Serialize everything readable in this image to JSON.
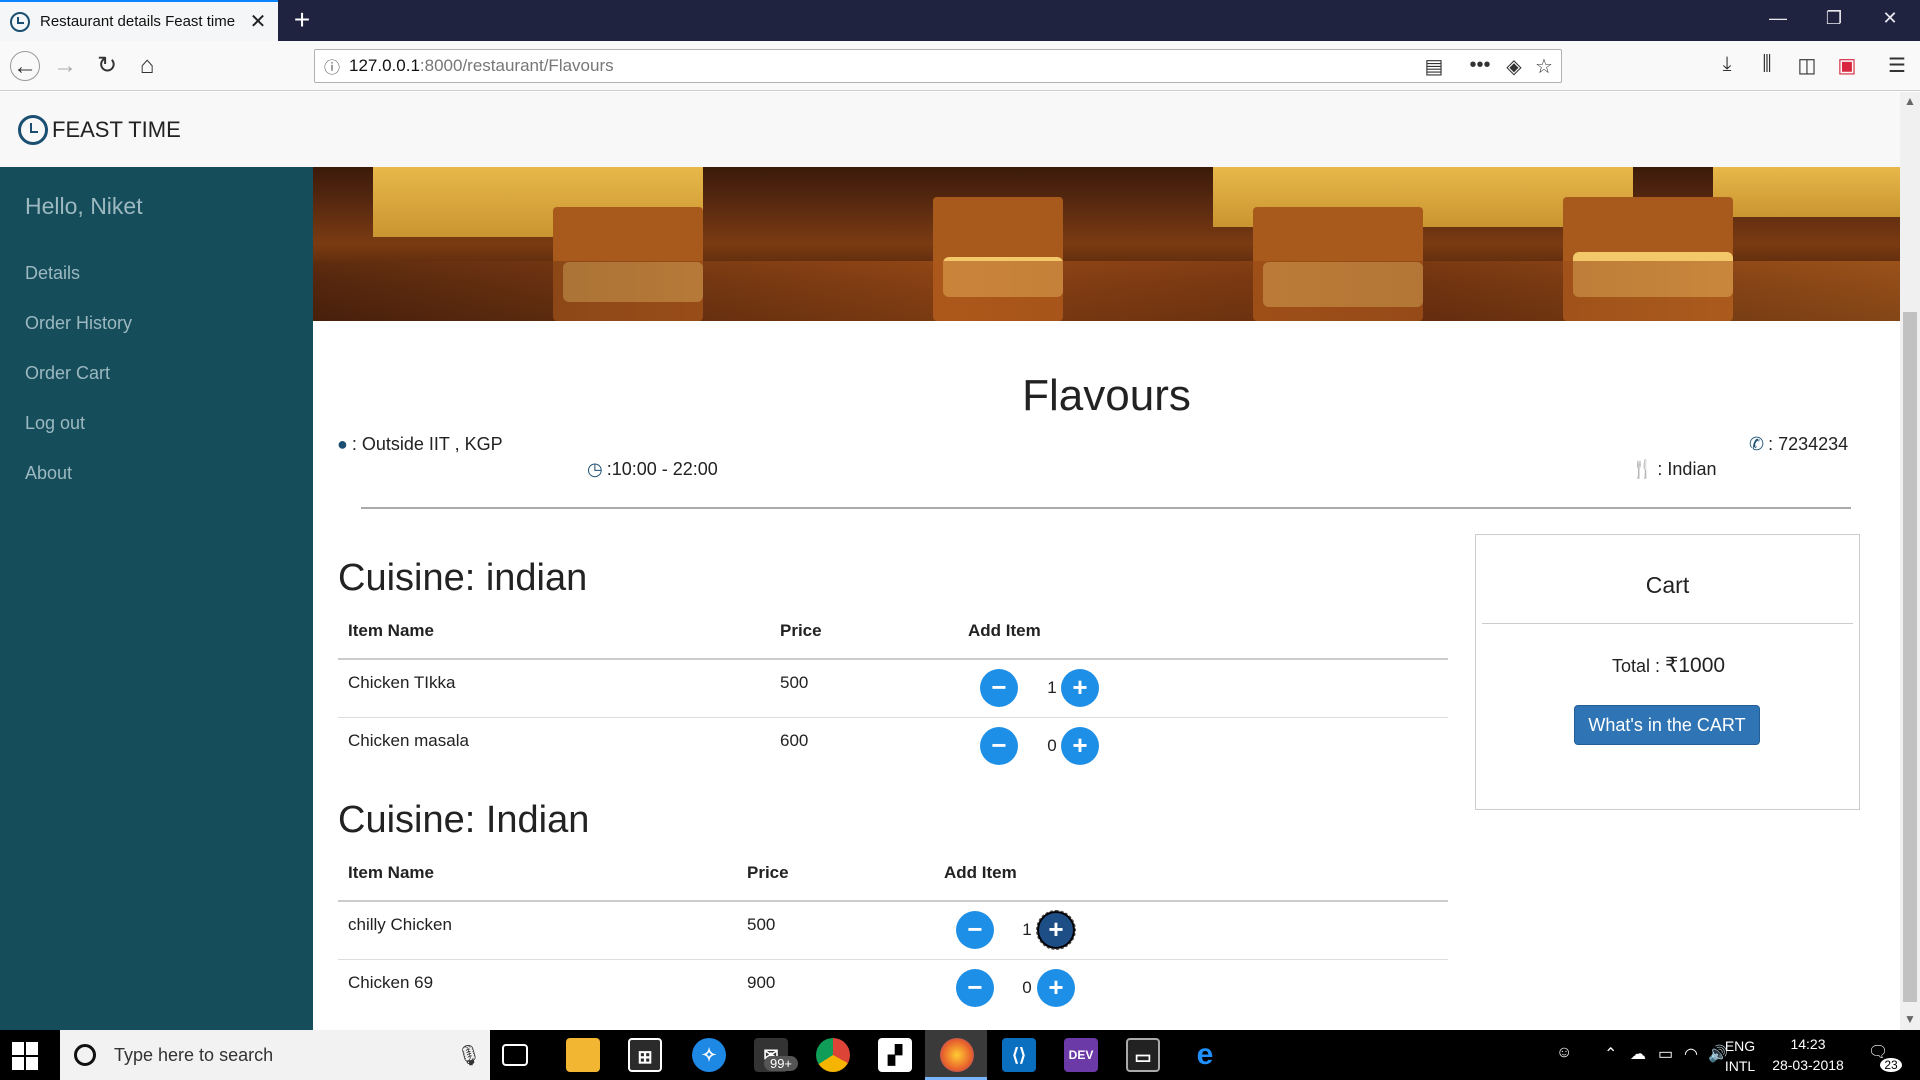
{
  "browser": {
    "tab_title": "Restaurant details Feast time",
    "tab_close": "✕",
    "new_tab": "+",
    "url_host": "127.0.0.1",
    "url_path": ":8000/restaurant/Flavours",
    "window": {
      "minimize": "—",
      "restore": "❐",
      "close": "✕"
    }
  },
  "site": {
    "brand": "FEAST TIME",
    "greeting": "Hello, Niket",
    "nav": [
      "Details",
      "Order History",
      "Order Cart",
      "Log out",
      "About"
    ]
  },
  "restaurant": {
    "name": "Flavours",
    "address": ": Outside IIT , KGP",
    "hours": ":10:00 - 22:00",
    "phone": ": 7234234",
    "cuisine": ": Indian"
  },
  "menus": [
    {
      "title": "Cuisine: indian",
      "headers": {
        "name": "Item Name",
        "price": "Price",
        "add": "Add Item"
      },
      "items": [
        {
          "name": "Chicken TIkka",
          "price": "500",
          "qty": "1"
        },
        {
          "name": "Chicken masala",
          "price": "600",
          "qty": "0"
        }
      ]
    },
    {
      "title": "Cuisine: Indian",
      "headers": {
        "name": "Item Name",
        "price": "Price",
        "add": "Add Item"
      },
      "items": [
        {
          "name": "chilly Chicken",
          "price": "500",
          "qty": "1"
        },
        {
          "name": "Chicken 69",
          "price": "900",
          "qty": "0"
        }
      ]
    }
  ],
  "cart": {
    "title": "Cart",
    "total_label": "Total : ",
    "total_value": "₹1000",
    "button": "What's in the CART"
  },
  "buttons": {
    "minus": "−",
    "plus": "+"
  },
  "taskbar": {
    "search_placeholder": "Type here to search",
    "mail_badge": "99+",
    "lang_top": "ENG",
    "lang_bottom": "INTL",
    "time": "14:23",
    "date": "28-03-2018",
    "notif_count": "23"
  },
  "colors": {
    "sidebar": "#164d5b",
    "accent_button": "#1e8fe6",
    "cart_button": "#2f74b5"
  }
}
